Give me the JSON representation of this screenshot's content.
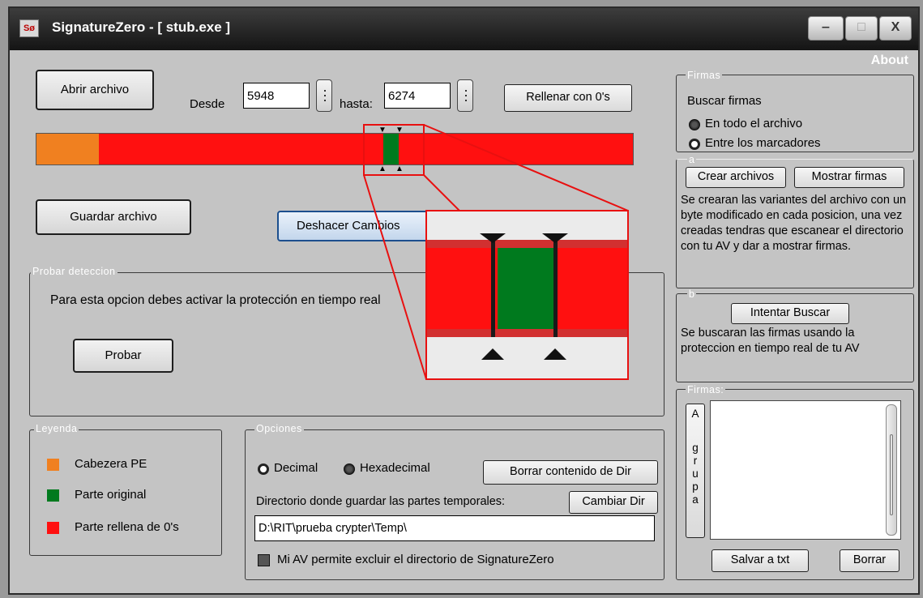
{
  "window": {
    "app_icon_text": "Sø",
    "title": "SignatureZero - [ stub.exe ]",
    "controls": {
      "minimize": "‒",
      "maximize": "□",
      "close": "X"
    }
  },
  "about": "About",
  "toolbar": {
    "open_file": "Abrir archivo",
    "from_label": "Desde",
    "from_value": "5948",
    "to_label": "hasta:",
    "to_value": "6274",
    "fill_zeros": "Rellenar con 0's",
    "save_file": "Guardar archivo",
    "undo_changes": "Deshacer Cambios"
  },
  "file_bar": {
    "colors": {
      "header": "#f08020",
      "original": "#007a1e",
      "filled": "#ff1010"
    },
    "segments": [
      {
        "kind": "header",
        "start": 0.0,
        "end": 0.104
      },
      {
        "kind": "filled",
        "start": 0.104,
        "end": 0.582
      },
      {
        "kind": "original",
        "start": 0.582,
        "end": 0.607
      },
      {
        "kind": "filled",
        "start": 0.607,
        "end": 1.0
      }
    ]
  },
  "test_detection": {
    "label": "Probar deteccion",
    "message": "Para esta opcion debes activar la protección en tiempo real",
    "test_button": "Probar"
  },
  "legend": {
    "label": "Leyenda",
    "items": [
      {
        "name": "Cabezera PE",
        "color": "#f08020"
      },
      {
        "name": "Parte original",
        "color": "#007a1e"
      },
      {
        "name": "Parte rellena de 0's",
        "color": "#ff1010"
      }
    ]
  },
  "options": {
    "label": "Opciones",
    "decimal": "Decimal",
    "hexadecimal": "Hexadecimal",
    "selected_format": "Hexadecimal",
    "clear_dir": "Borrar contenido de Dir",
    "dir_label": "Directorio donde guardar las partes temporales:",
    "change_dir": "Cambiar Dir",
    "dir_value": "D:\\RIT\\prueba crypter\\Temp\\",
    "exclude_check": "Mi AV permite excluir el directorio de SignatureZero",
    "exclude_checked": true
  },
  "signatures_panel": {
    "label": "Firmas",
    "search_label": "Buscar firmas",
    "radio_whole": "En todo el archivo",
    "radio_markers": "Entre los marcadores",
    "selected_scope": "En todo el archivo"
  },
  "section_a": {
    "label": "a",
    "create_files": "Crear archivos",
    "show_signatures": "Mostrar firmas",
    "description": "Se crearan las variantes del archivo con un byte modificado en cada posicion, una vez creadas tendras que escanear el directorio con tu AV y dar a mostrar firmas."
  },
  "section_b": {
    "label": "b",
    "try_search": "Intentar Buscar",
    "description": "Se buscaran las firmas usando la proteccion en tiempo real de tu AV"
  },
  "results": {
    "label": "Firmas:",
    "group_button_letters": [
      "A",
      "g",
      "r",
      "u",
      "p",
      "a"
    ],
    "save_txt": "Salvar a txt",
    "clear": "Borrar"
  }
}
